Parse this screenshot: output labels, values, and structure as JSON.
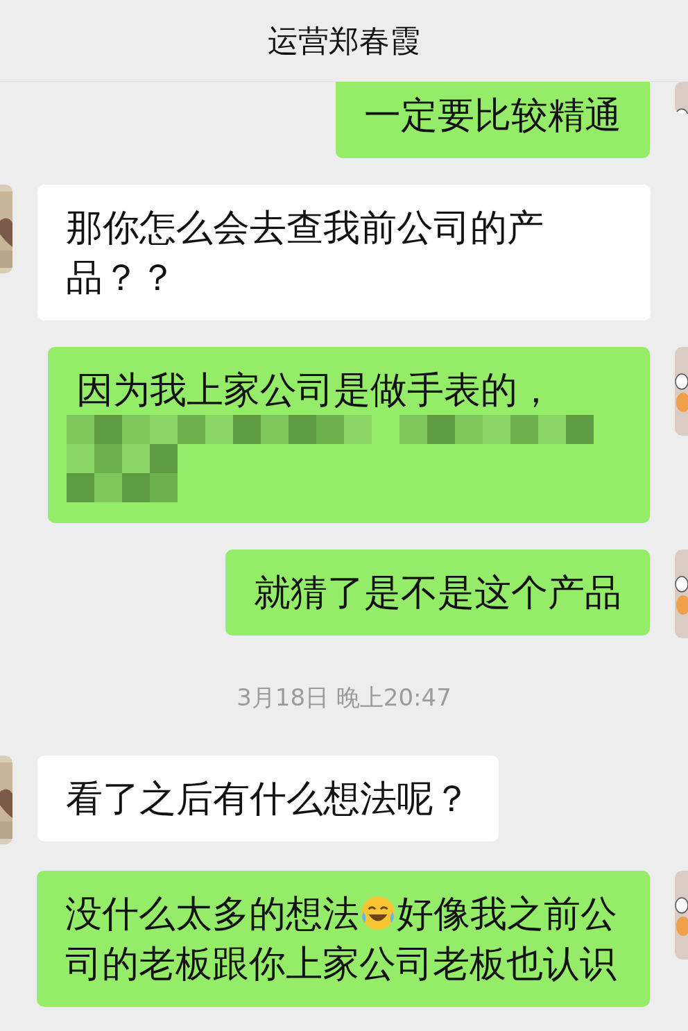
{
  "header": {
    "title": "运营郑春霞"
  },
  "messages": [
    {
      "kind": "message",
      "outgoing": true,
      "redacted": false,
      "parts": [
        {
          "kind": "text",
          "text": "一定要比较精通"
        }
      ]
    },
    {
      "kind": "message",
      "outgoing": false,
      "redacted": false,
      "parts": [
        {
          "kind": "text",
          "text": "那你怎么会去查我前公司的产品？？"
        }
      ]
    },
    {
      "kind": "message",
      "outgoing": true,
      "redacted": true,
      "parts": [
        {
          "kind": "text",
          "text": "因为我上家公司是做手表的，"
        }
      ]
    },
    {
      "kind": "message",
      "outgoing": true,
      "redacted": false,
      "parts": [
        {
          "kind": "text",
          "text": "就猜了是不是这个产品"
        }
      ]
    },
    {
      "kind": "time",
      "text": "3月18日 晚上20:47"
    },
    {
      "kind": "message",
      "outgoing": false,
      "redacted": false,
      "parts": [
        {
          "kind": "text",
          "text": "看了之后有什么想法呢？"
        }
      ]
    },
    {
      "kind": "message",
      "outgoing": true,
      "redacted": false,
      "parts": [
        {
          "kind": "text",
          "text": "没什么太多的想法"
        },
        {
          "kind": "emoji"
        },
        {
          "kind": "text",
          "text": "好像我之前公司的老板跟你上家公司老板也认识"
        }
      ]
    }
  ]
}
